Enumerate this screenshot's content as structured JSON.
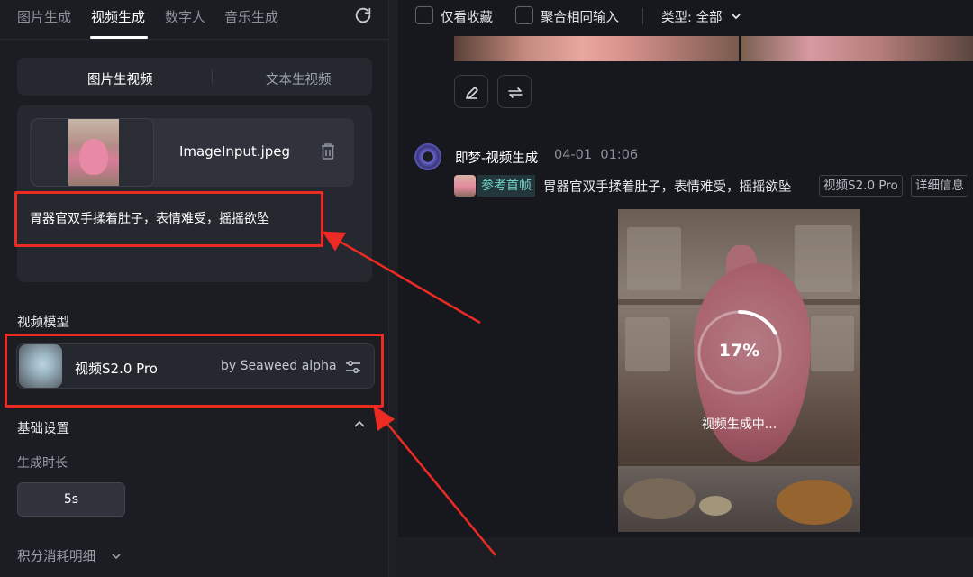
{
  "nav": {
    "tabs": [
      "图片生成",
      "视频生成",
      "数字人",
      "音乐生成"
    ],
    "active_tab": "视频生成"
  },
  "mode": {
    "options": [
      "图片生视频",
      "文本生视频"
    ],
    "active": "图片生视频"
  },
  "upload": {
    "filename": "ImageInput.jpeg"
  },
  "prompt": {
    "text": "胃器官双手揉着肚子，表情难受，摇摇欲坠"
  },
  "model_section": {
    "label": "视频模型",
    "model_name": "视频S2.0 Pro",
    "provider": "by Seaweed alpha"
  },
  "basic_settings": {
    "label": "基础设置",
    "duration_label": "生成时长",
    "duration_value": "5s"
  },
  "cost_details": {
    "label": "积分消耗明细"
  },
  "filters": {
    "favorites_only": "仅看收藏",
    "merge_same_input": "聚合相同输入",
    "type_label": "类型: 全部"
  },
  "task": {
    "author": "即梦-视频生成",
    "date": "04-01",
    "time": "01:06",
    "ref_tag": "参考首帧",
    "description": "胃器官双手揉着肚子，表情难受，摇摇欲坠",
    "model_pill": "视频S2.0 Pro",
    "details_pill": "详细信息",
    "progress_percent": 17,
    "progress_text": "17%",
    "status_text": "视频生成中..."
  },
  "colors": {
    "highlight_border": "#ec2b23",
    "ref_tag_text": "#6fd0c2",
    "panel_bg": "#1b1d23"
  },
  "icons": {
    "refresh": "refresh-icon",
    "trash": "trash-icon",
    "settings": "sliders-icon",
    "edit": "pencil-icon",
    "regenerate": "repeat-icon"
  }
}
